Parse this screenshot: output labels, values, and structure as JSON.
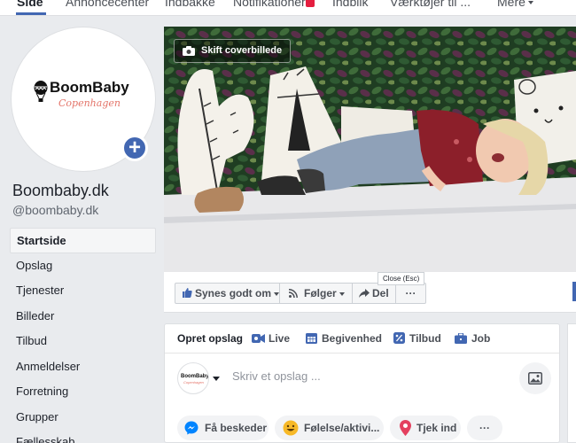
{
  "topnav": {
    "items": [
      "Side",
      "Annoncecenter",
      "Indbakke",
      "Notifikationer",
      "Indblik",
      "Værktøjer til ...",
      "Mere"
    ],
    "active_index": 0
  },
  "profile": {
    "brand": "BoomBaby",
    "brand_sub": "Copenhagen",
    "name": "Boombaby.dk",
    "handle": "@boombaby.dk"
  },
  "leftnav": {
    "items": [
      "Startside",
      "Opslag",
      "Tjenester",
      "Billeder",
      "Tilbud",
      "Anmeldelser",
      "Forretning",
      "Grupper",
      "Fællesskab"
    ],
    "active_index": 0
  },
  "cover": {
    "change_label": "Skift coverbillede"
  },
  "actions": {
    "like": "Synes godt om",
    "follow": "Følger",
    "share": "Del",
    "more": "···",
    "tooltip": "Close (Esc)"
  },
  "composer": {
    "tabs": [
      "Opret opslag",
      "Live",
      "Begivenhed",
      "Tilbud",
      "Job"
    ],
    "placeholder": "Skriv et opslag ...",
    "pills": [
      "Få beskeder",
      "Følelse/aktivi...",
      "Tjek ind",
      "···"
    ]
  },
  "colors": {
    "accent": "#4267b2",
    "background": "#e9ebee",
    "badge": "#e41e3f",
    "brand_sub": "#e4756a"
  }
}
